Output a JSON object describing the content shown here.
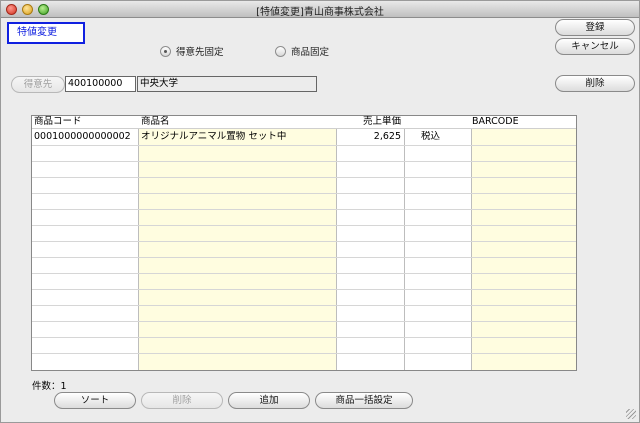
{
  "window": {
    "title": "[特値変更]青山商事株式会社"
  },
  "mode_label": "特値変更",
  "radios": [
    {
      "label": "得意先固定",
      "selected": true
    },
    {
      "label": "商品固定",
      "selected": false
    }
  ],
  "buttons": {
    "register": "登録",
    "cancel": "キャンセル",
    "delete": "削除"
  },
  "customer": {
    "button": "得意先",
    "code": "400100000",
    "name": "中央大学"
  },
  "table": {
    "columns": [
      "商品コード",
      "商品名",
      "売上単価",
      "",
      "BARCODE"
    ],
    "rows": [
      {
        "code": "0001000000000002",
        "name": "オリジナルアニマル置物 セット中",
        "price": "2,625",
        "tax": "税込",
        "barcode": ""
      }
    ]
  },
  "count": {
    "label": "件数：",
    "value": "1"
  },
  "footer_buttons": {
    "sort": "ソート",
    "delete": "削除",
    "add": "追加",
    "bulk": "商品一括設定"
  },
  "colors": {
    "selection_border": "#1020e0",
    "column_highlight": "#fffde0"
  }
}
